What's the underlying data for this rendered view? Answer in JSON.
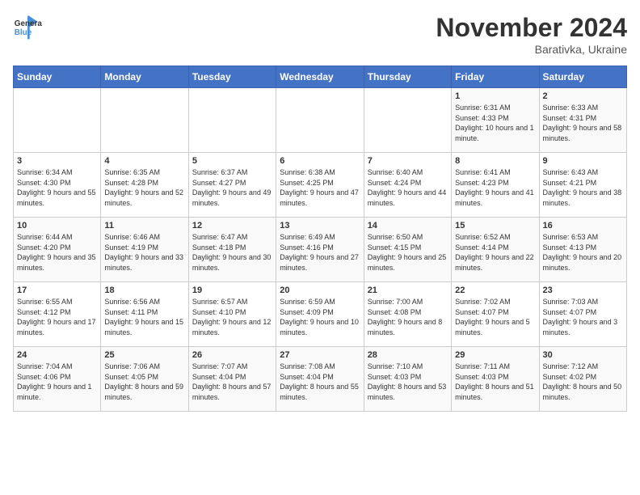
{
  "logo": {
    "general": "General",
    "blue": "Blue"
  },
  "title": "November 2024",
  "location": "Barativka, Ukraine",
  "days_of_week": [
    "Sunday",
    "Monday",
    "Tuesday",
    "Wednesday",
    "Thursday",
    "Friday",
    "Saturday"
  ],
  "weeks": [
    [
      {
        "day": "",
        "info": ""
      },
      {
        "day": "",
        "info": ""
      },
      {
        "day": "",
        "info": ""
      },
      {
        "day": "",
        "info": ""
      },
      {
        "day": "",
        "info": ""
      },
      {
        "day": "1",
        "info": "Sunrise: 6:31 AM\nSunset: 4:33 PM\nDaylight: 10 hours and 1 minute."
      },
      {
        "day": "2",
        "info": "Sunrise: 6:33 AM\nSunset: 4:31 PM\nDaylight: 9 hours and 58 minutes."
      }
    ],
    [
      {
        "day": "3",
        "info": "Sunrise: 6:34 AM\nSunset: 4:30 PM\nDaylight: 9 hours and 55 minutes."
      },
      {
        "day": "4",
        "info": "Sunrise: 6:35 AM\nSunset: 4:28 PM\nDaylight: 9 hours and 52 minutes."
      },
      {
        "day": "5",
        "info": "Sunrise: 6:37 AM\nSunset: 4:27 PM\nDaylight: 9 hours and 49 minutes."
      },
      {
        "day": "6",
        "info": "Sunrise: 6:38 AM\nSunset: 4:25 PM\nDaylight: 9 hours and 47 minutes."
      },
      {
        "day": "7",
        "info": "Sunrise: 6:40 AM\nSunset: 4:24 PM\nDaylight: 9 hours and 44 minutes."
      },
      {
        "day": "8",
        "info": "Sunrise: 6:41 AM\nSunset: 4:23 PM\nDaylight: 9 hours and 41 minutes."
      },
      {
        "day": "9",
        "info": "Sunrise: 6:43 AM\nSunset: 4:21 PM\nDaylight: 9 hours and 38 minutes."
      }
    ],
    [
      {
        "day": "10",
        "info": "Sunrise: 6:44 AM\nSunset: 4:20 PM\nDaylight: 9 hours and 35 minutes."
      },
      {
        "day": "11",
        "info": "Sunrise: 6:46 AM\nSunset: 4:19 PM\nDaylight: 9 hours and 33 minutes."
      },
      {
        "day": "12",
        "info": "Sunrise: 6:47 AM\nSunset: 4:18 PM\nDaylight: 9 hours and 30 minutes."
      },
      {
        "day": "13",
        "info": "Sunrise: 6:49 AM\nSunset: 4:16 PM\nDaylight: 9 hours and 27 minutes."
      },
      {
        "day": "14",
        "info": "Sunrise: 6:50 AM\nSunset: 4:15 PM\nDaylight: 9 hours and 25 minutes."
      },
      {
        "day": "15",
        "info": "Sunrise: 6:52 AM\nSunset: 4:14 PM\nDaylight: 9 hours and 22 minutes."
      },
      {
        "day": "16",
        "info": "Sunrise: 6:53 AM\nSunset: 4:13 PM\nDaylight: 9 hours and 20 minutes."
      }
    ],
    [
      {
        "day": "17",
        "info": "Sunrise: 6:55 AM\nSunset: 4:12 PM\nDaylight: 9 hours and 17 minutes."
      },
      {
        "day": "18",
        "info": "Sunrise: 6:56 AM\nSunset: 4:11 PM\nDaylight: 9 hours and 15 minutes."
      },
      {
        "day": "19",
        "info": "Sunrise: 6:57 AM\nSunset: 4:10 PM\nDaylight: 9 hours and 12 minutes."
      },
      {
        "day": "20",
        "info": "Sunrise: 6:59 AM\nSunset: 4:09 PM\nDaylight: 9 hours and 10 minutes."
      },
      {
        "day": "21",
        "info": "Sunrise: 7:00 AM\nSunset: 4:08 PM\nDaylight: 9 hours and 8 minutes."
      },
      {
        "day": "22",
        "info": "Sunrise: 7:02 AM\nSunset: 4:07 PM\nDaylight: 9 hours and 5 minutes."
      },
      {
        "day": "23",
        "info": "Sunrise: 7:03 AM\nSunset: 4:07 PM\nDaylight: 9 hours and 3 minutes."
      }
    ],
    [
      {
        "day": "24",
        "info": "Sunrise: 7:04 AM\nSunset: 4:06 PM\nDaylight: 9 hours and 1 minute."
      },
      {
        "day": "25",
        "info": "Sunrise: 7:06 AM\nSunset: 4:05 PM\nDaylight: 8 hours and 59 minutes."
      },
      {
        "day": "26",
        "info": "Sunrise: 7:07 AM\nSunset: 4:04 PM\nDaylight: 8 hours and 57 minutes."
      },
      {
        "day": "27",
        "info": "Sunrise: 7:08 AM\nSunset: 4:04 PM\nDaylight: 8 hours and 55 minutes."
      },
      {
        "day": "28",
        "info": "Sunrise: 7:10 AM\nSunset: 4:03 PM\nDaylight: 8 hours and 53 minutes."
      },
      {
        "day": "29",
        "info": "Sunrise: 7:11 AM\nSunset: 4:03 PM\nDaylight: 8 hours and 51 minutes."
      },
      {
        "day": "30",
        "info": "Sunrise: 7:12 AM\nSunset: 4:02 PM\nDaylight: 8 hours and 50 minutes."
      }
    ]
  ]
}
